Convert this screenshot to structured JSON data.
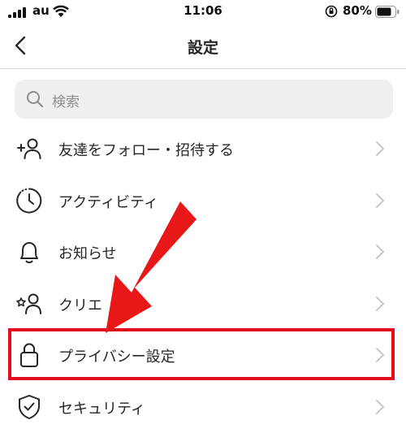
{
  "status_bar": {
    "carrier": "au",
    "time": "11:06",
    "battery_percent": "80%",
    "icons": [
      "signal-icon",
      "wifi-icon",
      "orientation-lock-icon",
      "battery-icon"
    ]
  },
  "nav": {
    "title": "設定",
    "back_icon": "chevron-left-icon"
  },
  "search": {
    "placeholder": "検索",
    "icon": "search-icon"
  },
  "menu": {
    "items": [
      {
        "label": "友達をフォロー・招待する",
        "icon": "add-person-icon"
      },
      {
        "label": "アクティビティ",
        "icon": "activity-clock-icon"
      },
      {
        "label": "お知らせ",
        "icon": "bell-icon"
      },
      {
        "label": "クリエ",
        "icon": "creator-icon"
      },
      {
        "label": "プライバシー設定",
        "icon": "lock-icon"
      },
      {
        "label": "セキュリティ",
        "icon": "shield-icon"
      }
    ]
  },
  "annotation": {
    "highlighted_item": "プライバシー設定",
    "color": "#e10d1c"
  },
  "colors": {
    "text": "#262626",
    "chevron": "#c7c7c7",
    "search_bg": "#efefef",
    "highlight": "#e10d1c"
  }
}
